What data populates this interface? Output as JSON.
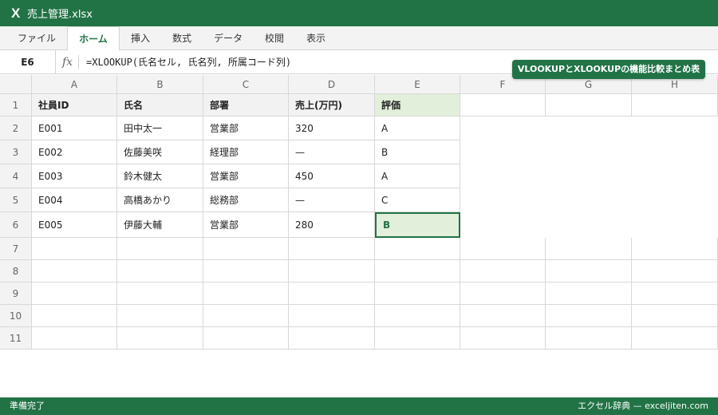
{
  "window": {
    "title": "売上管理.xlsx",
    "app_icon": "X"
  },
  "ribbon": {
    "tabs": [
      "ファイル",
      "ホーム",
      "挿入",
      "数式",
      "データ",
      "校閲",
      "表示"
    ],
    "active": "ホーム"
  },
  "formula_bar": {
    "name_box": "E6",
    "fx_label": "fx",
    "formula": "=XLOOKUP(氏名セル, 氏名列, 所属コード列)"
  },
  "badge": "VLOOKUPとXLOOKUPの機能比較まとめ表",
  "sheet": {
    "columns": [
      "A",
      "B",
      "C",
      "D",
      "E",
      "F",
      "G",
      "H"
    ],
    "row_numbers": [
      "1",
      "2",
      "3",
      "4",
      "5",
      "6",
      "7",
      "8",
      "9",
      "10",
      "11"
    ],
    "header": [
      "社員ID",
      "氏名",
      "部署",
      "売上(万円)",
      "評価"
    ],
    "rows": [
      [
        "E001",
        "田中太一",
        "営業部",
        "320",
        "A"
      ],
      [
        "E002",
        "佐藤美咲",
        "経理部",
        "—",
        "B"
      ],
      [
        "E003",
        "鈴木健太",
        "営業部",
        "450",
        "A"
      ],
      [
        "E004",
        "高橋あかり",
        "総務部",
        "—",
        "C"
      ],
      [
        "E005",
        "伊藤大輔",
        "営業部",
        "280",
        "B"
      ]
    ],
    "active_cell": "E6"
  },
  "status": {
    "left": "準備完了",
    "right": "エクセル辞典 — exceljiten.com"
  },
  "colors": {
    "accent": "#217346",
    "highlight": "#e2efda"
  }
}
